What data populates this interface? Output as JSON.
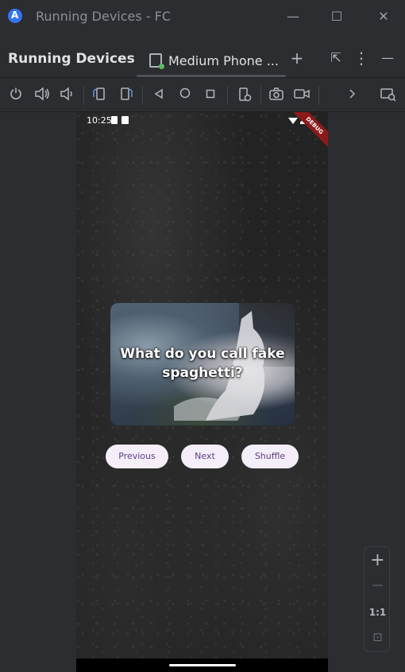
{
  "window": {
    "title": "Running Devices - FC",
    "minimize_glyph": "—",
    "maximize_glyph": "☐",
    "close_glyph": "✕"
  },
  "panel": {
    "title": "Running Devices",
    "tab_label": "Medium Phone ...",
    "add_glyph": "+",
    "more_glyph": "⋮",
    "collapse_glyph": "—",
    "restore_glyph": "⇱"
  },
  "toolbar": {
    "icons": [
      "power-icon",
      "volume-up-icon",
      "volume-down-icon",
      "rotate-left-icon",
      "rotate-right-icon",
      "back-icon",
      "home-icon",
      "overview-icon",
      "device-settings-icon",
      "screenshot-icon",
      "screen-record-icon",
      "chevron-right-icon",
      "device-mirroring-icon"
    ]
  },
  "device": {
    "status_time": "10:25",
    "debug_label": "DEBUG",
    "card_text": "What do you call fake spaghetti?",
    "buttons": {
      "previous": "Previous",
      "next": "Next",
      "shuffle": "Shuffle"
    }
  },
  "zoom": {
    "zoom_in": "+",
    "zoom_out": "—",
    "actual_size": "1:1",
    "fit_glyph": "⊡"
  }
}
